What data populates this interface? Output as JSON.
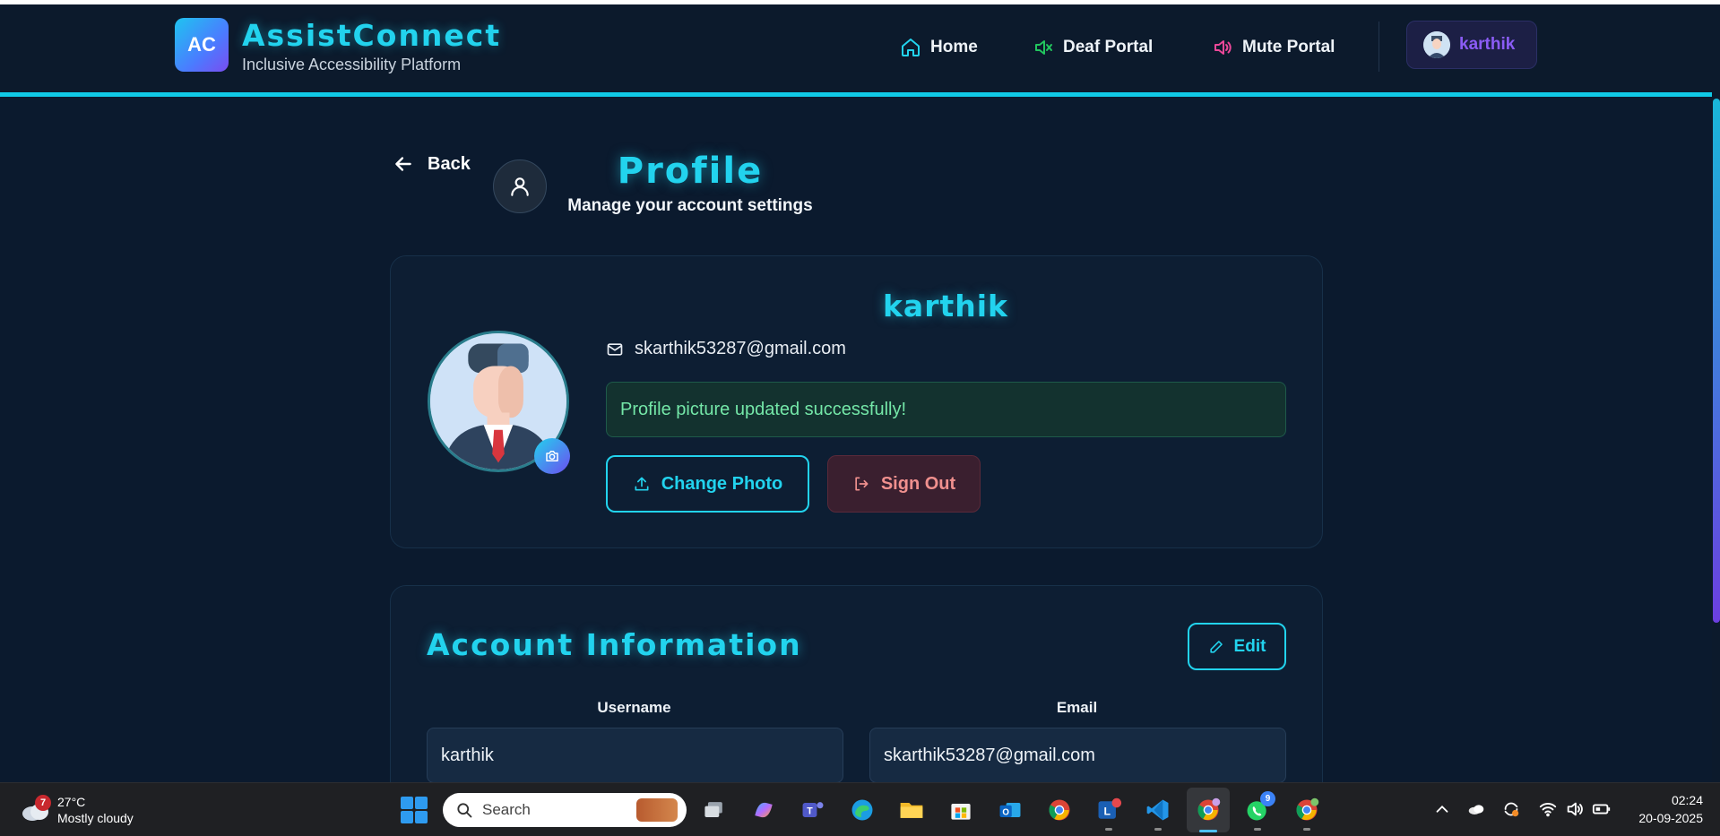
{
  "brand": {
    "logo_text": "AC",
    "title": "AssistConnect",
    "subtitle": "Inclusive Accessibility Platform"
  },
  "nav": {
    "home": "Home",
    "deaf": "Deaf Portal",
    "mute": "Mute Portal",
    "user": "karthik"
  },
  "header": {
    "back": "Back",
    "title": "Profile",
    "subtitle": "Manage your account settings"
  },
  "profile": {
    "name": "karthik",
    "email": "skarthik53287@gmail.com",
    "success_message": "Profile picture updated successfully!",
    "change_photo": "Change Photo",
    "sign_out": "Sign Out"
  },
  "account": {
    "title": "Account Information",
    "edit": "Edit",
    "username_label": "Username",
    "username_value": "karthik",
    "email_label": "Email",
    "email_value": "skarthik53287@gmail.com"
  },
  "taskbar": {
    "weather_alerts": "7",
    "temperature": "27°C",
    "condition": "Mostly cloudy",
    "search_placeholder": "Search",
    "whatsapp_badge": "9",
    "time": "02:24",
    "date": "20-09-2025"
  },
  "colors": {
    "accent": "#22d3ee",
    "purple": "#8b5cf6",
    "success": "#74e7a8",
    "danger": "#f0908e"
  }
}
